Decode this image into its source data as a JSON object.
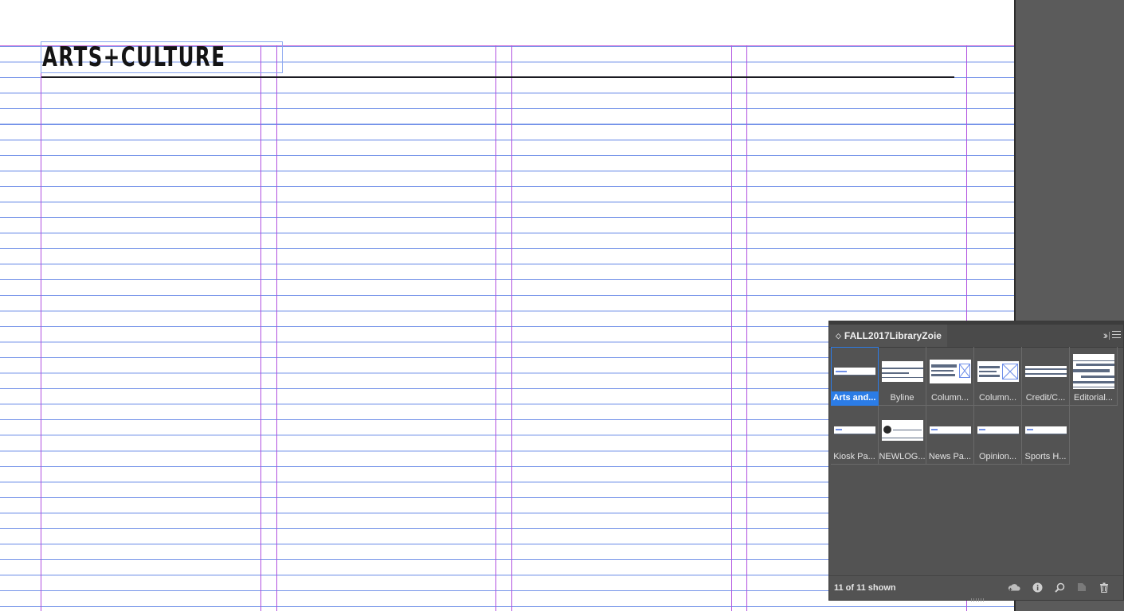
{
  "document": {
    "masthead_title": "ARTS+CULTURE",
    "guide_color": "#b050e0",
    "baseline_color": "#6f8fe8"
  },
  "library_panel": {
    "title": "FALL2017LibraryZoie",
    "items": [
      {
        "label": "Arts and...",
        "selected": true
      },
      {
        "label": "Byline"
      },
      {
        "label": "Column..."
      },
      {
        "label": "Column..."
      },
      {
        "label": "Credit/C..."
      },
      {
        "label": "Editorial..."
      },
      {
        "label": "Kiosk Pa..."
      },
      {
        "label": "NEWLOG..."
      },
      {
        "label": "News Pa..."
      },
      {
        "label": "Opinion..."
      },
      {
        "label": "Sports H..."
      }
    ],
    "status": "11 of 11 shown",
    "footer_icons": [
      "cloud-upload-icon",
      "info-icon",
      "search-icon",
      "new-item-icon",
      "trash-icon"
    ],
    "accent": "#2b7ce6"
  }
}
